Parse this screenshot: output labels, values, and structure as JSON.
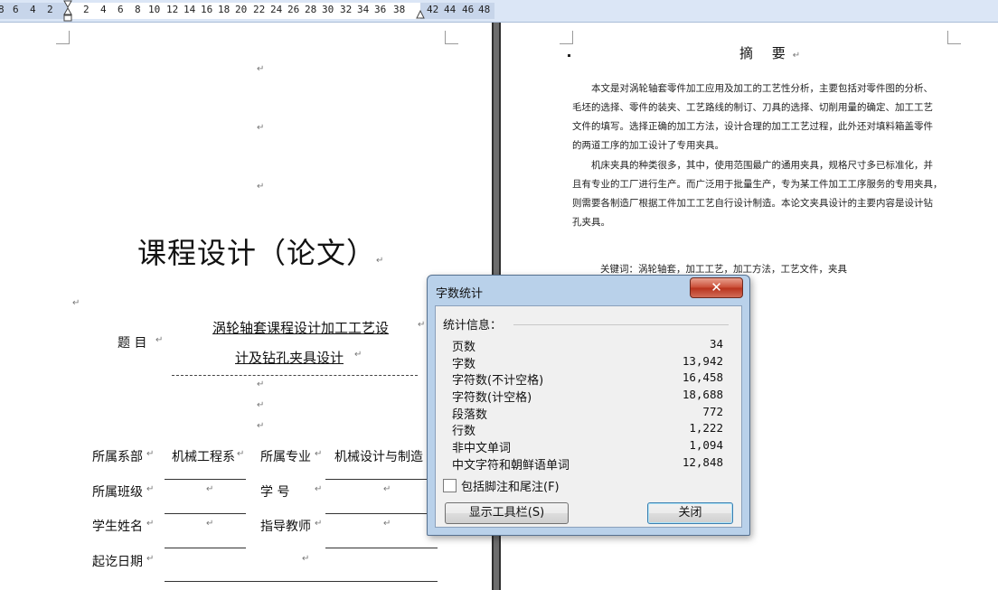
{
  "ruler": {
    "ticks": [
      "8",
      "6",
      "4",
      "2",
      "2",
      "4",
      "6",
      "8",
      "10",
      "12",
      "14",
      "16",
      "18",
      "20",
      "22",
      "24",
      "26",
      "28",
      "30",
      "32",
      "34",
      "36",
      "38",
      "42",
      "44",
      "46",
      "48"
    ]
  },
  "left_page": {
    "title": "课程设计（论文）",
    "topic_label": "题    目",
    "topic_line1": "涡轮轴套课程设计加工工艺设",
    "topic_line2": "计及钻孔夹具设计",
    "dept_label": "所属系部",
    "dept_value": "机械工程系",
    "major_label": "所属专业",
    "major_value": "机械设计与制造",
    "class_label": "所属班级",
    "student_id_label": "学      号",
    "name_label": "学生姓名",
    "advisor_label": "指导教师",
    "date_label": "起讫日期",
    "para_mark": "↵"
  },
  "right_page": {
    "abstract_title": "摘  要",
    "lines": [
      "本文是对涡轮轴套零件加工应用及加工的工艺性分析，主要包括对零件图的分析、",
      "毛坯的选择、零件的装夹、工艺路线的制订、刀具的选择、切削用量的确定、加工工艺",
      "文件的填写。选择正确的加工方法，设计合理的加工工艺过程，此外还对填料箱盖零件",
      "的两道工序的加工设计了专用夹具。",
      "机床夹具的种类很多，其中，使用范围最广的通用夹具，规格尺寸多已标准化，并",
      "且有专业的工厂进行生产。而广泛用于批量生产，专为某工件加工工序服务的专用夹具，",
      "则需要各制造厂根据工件加工工艺自行设计制造。本论文夹具设计的主要内容是设计钻",
      "孔夹具。"
    ],
    "keywords": "关键词：涡轮轴套，加工工艺，加工方法，工艺文件，夹具"
  },
  "dialog": {
    "title": "字数统计",
    "close_glyph": "✕",
    "group_label": "统计信息：",
    "stats": [
      {
        "label": "页数",
        "value": "34"
      },
      {
        "label": "字数",
        "value": "13,942"
      },
      {
        "label": "字符数(不计空格)",
        "value": "16,458"
      },
      {
        "label": "字符数(计空格)",
        "value": "18,688"
      },
      {
        "label": "段落数",
        "value": "772"
      },
      {
        "label": "行数",
        "value": "1,222"
      },
      {
        "label": "非中文单词",
        "value": "1,094"
      },
      {
        "label": "中文字符和朝鲜语单词",
        "value": "12,848"
      }
    ],
    "include_footnotes_label": "包括脚注和尾注(F)",
    "include_footnotes_checked": false,
    "show_toolbar_label": "显示工具栏(S)",
    "close_label": "关闭"
  }
}
